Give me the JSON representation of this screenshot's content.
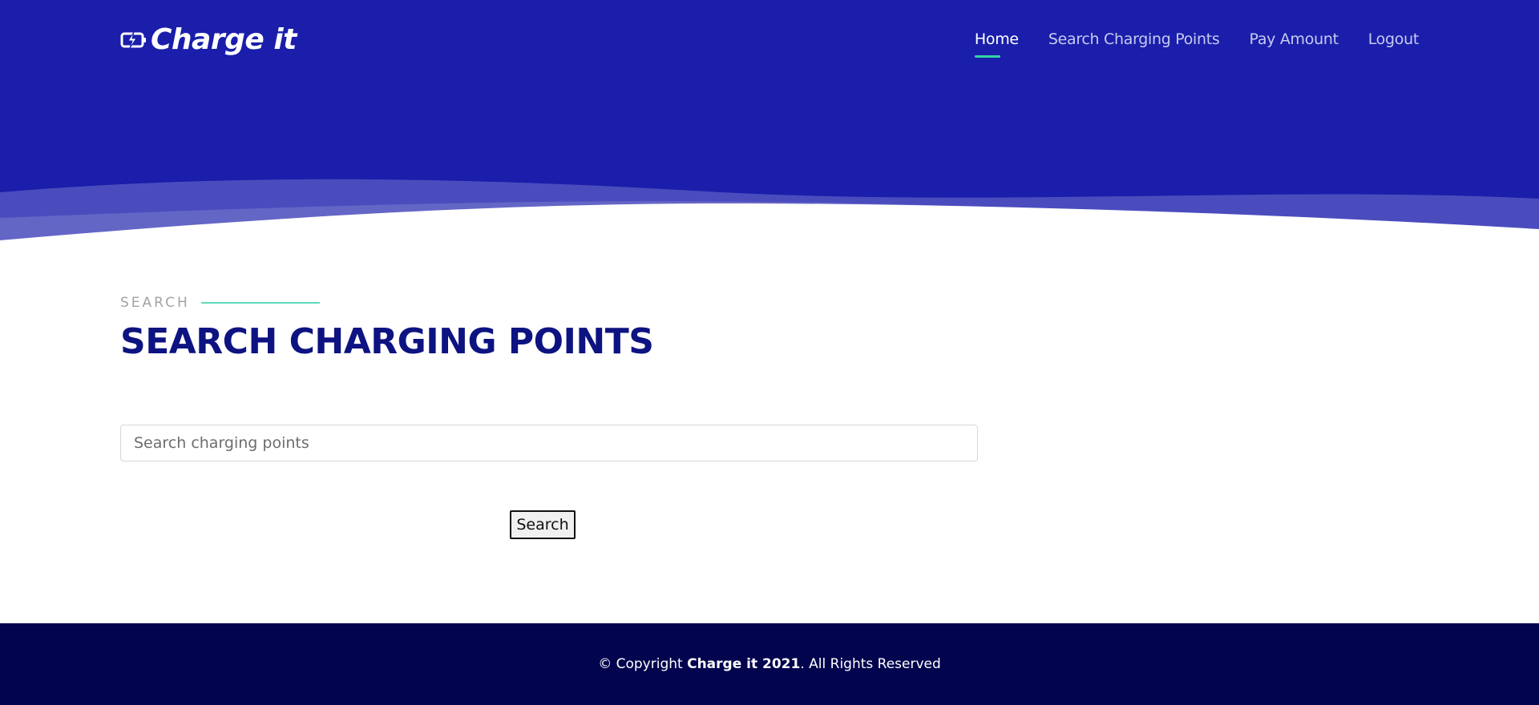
{
  "brand": {
    "name": "Charge it",
    "icon": "battery-bolt-icon"
  },
  "nav": {
    "items": [
      {
        "label": "Home",
        "active": true
      },
      {
        "label": "Search Charging Points",
        "active": false
      },
      {
        "label": "Pay Amount",
        "active": false
      },
      {
        "label": "Logout",
        "active": false
      }
    ]
  },
  "section": {
    "kicker": "SEARCH",
    "title": "SEARCH CHARGING POINTS"
  },
  "search": {
    "placeholder": "Search charging points",
    "value": "",
    "button_label": "Search"
  },
  "footer": {
    "prefix": "© Copyright ",
    "brand": "Charge it 2021",
    "suffix": ". All Rights Reserved"
  },
  "colors": {
    "hero_bg": "#1a1eaa",
    "accent": "#32d6a4",
    "title": "#0d1380",
    "footer_bg": "#02044e"
  }
}
